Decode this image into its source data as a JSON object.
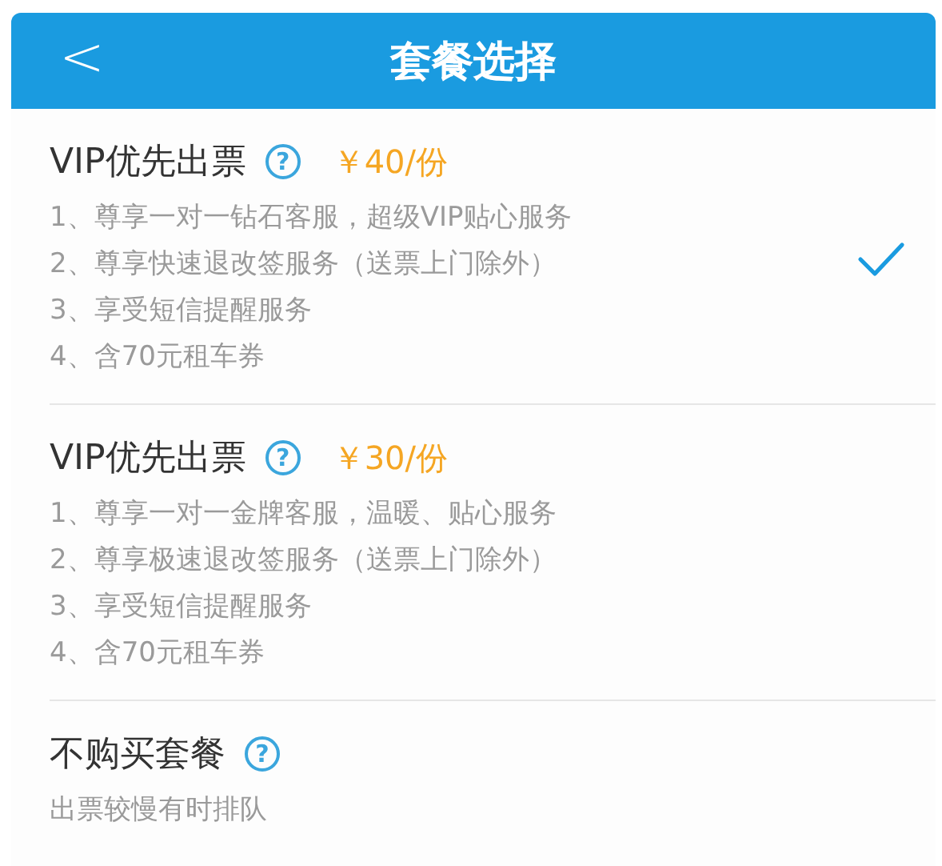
{
  "header": {
    "back_glyph": "<",
    "title": "套餐选择"
  },
  "options": [
    {
      "title": "VIP优先出票",
      "help": "?",
      "price": "￥40/份",
      "selected": true,
      "lines": [
        "1、尊享一对一钻石客服，超级VIP贴心服务",
        "2、尊享快速退改签服务（送票上门除外）",
        "3、享受短信提醒服务",
        "4、含70元租车券"
      ]
    },
    {
      "title": "VIP优先出票",
      "help": "?",
      "price": "￥30/份",
      "selected": false,
      "lines": [
        "1、尊享一对一金牌客服，温暖、贴心服务",
        "2、尊享极速退改签服务（送票上门除外）",
        "3、享受短信提醒服务",
        "4、含70元租车券"
      ]
    },
    {
      "title": "不购买套餐",
      "help": "?",
      "selected": false,
      "lines": [
        "出票较慢有时排队"
      ]
    }
  ]
}
